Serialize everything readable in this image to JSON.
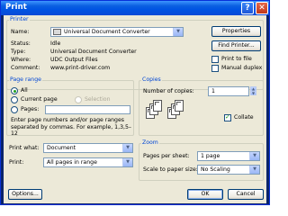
{
  "window": {
    "title": "Print",
    "help_glyph": "?",
    "close_glyph": "✕"
  },
  "printer": {
    "group_label": "Printer",
    "name_label": "Name:",
    "name_value": "Universal Document Converter",
    "properties_label": "Properties",
    "find_printer_label": "Find Printer...",
    "status_label": "Status:",
    "status_value": "Idle",
    "type_label": "Type:",
    "type_value": "Universal Document Converter",
    "where_label": "Where:",
    "where_value": "UDC Output Files",
    "comment_label": "Comment:",
    "comment_value": "www.print-driver.com",
    "print_to_file_label": "Print to file",
    "manual_duplex_label": "Manual duplex"
  },
  "page_range": {
    "group_label": "Page range",
    "all_label": "All",
    "current_page_label": "Current page",
    "selection_label": "Selection",
    "pages_label": "Pages:",
    "pages_value": "",
    "hint": "Enter page numbers and/or page ranges separated by commas.  For example, 1,3,5–12"
  },
  "copies": {
    "group_label": "Copies",
    "number_label": "Number of copies:",
    "number_value": "1",
    "collate_label": "Collate",
    "collate_checked": true
  },
  "print_what": {
    "label": "Print what:",
    "value": "Document"
  },
  "print": {
    "label": "Print:",
    "value": "All pages in range"
  },
  "zoom": {
    "group_label": "Zoom",
    "pages_per_sheet_label": "Pages per sheet:",
    "pages_per_sheet_value": "1 page",
    "scale_label": "Scale to paper size:",
    "scale_value": "No Scaling"
  },
  "footer": {
    "options_label": "Options...",
    "ok_label": "OK",
    "cancel_label": "Cancel"
  },
  "icons": {
    "dropdown": "chevron-down-icon",
    "spin_up": "up-arrow-icon",
    "spin_down": "down-arrow-icon"
  }
}
